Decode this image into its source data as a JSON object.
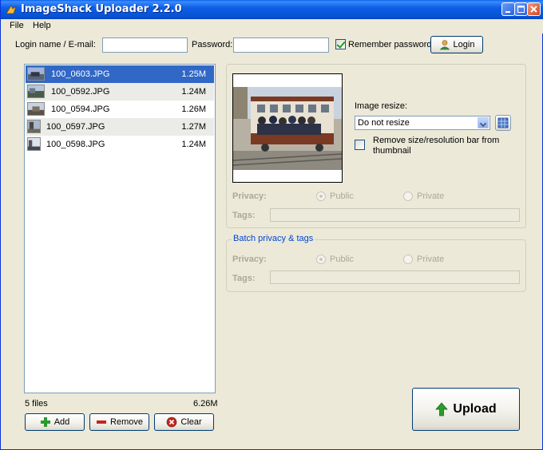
{
  "window": {
    "title": "ImageShack Uploader 2.2.0",
    "minimize": "_",
    "maximize": "□",
    "close": "×"
  },
  "menu": [
    "File",
    "Help"
  ],
  "login": {
    "login_label": "Login name / E-mail:",
    "login_value": "",
    "password_label": "Password:",
    "password_value": "",
    "remember_label": "Remember password",
    "remember_checked": true,
    "login_button": "Login"
  },
  "files": {
    "items": [
      {
        "name": "100_0603.JPG",
        "size": "1.25M",
        "selected": true
      },
      {
        "name": "100_0592.JPG",
        "size": "1.24M",
        "selected": false
      },
      {
        "name": "100_0594.JPG",
        "size": "1.26M",
        "selected": false
      },
      {
        "name": "100_0597.JPG",
        "size": "1.27M",
        "selected": false
      },
      {
        "name": "100_0598.JPG",
        "size": "1.24M",
        "selected": false
      }
    ],
    "count_label": "5 files",
    "total_size": "6.26M",
    "add_button": "Add",
    "remove_button": "Remove",
    "clear_button": "Clear"
  },
  "details": {
    "resize_label": "Image resize:",
    "resize_value": "Do not resize",
    "remove_bar_label": "Remove size/resolution bar from thumbnail",
    "remove_bar_checked": false,
    "privacy_label": "Privacy:",
    "public_label": "Public",
    "private_label": "Private",
    "tags_label": "Tags:"
  },
  "batch": {
    "title": "Batch privacy & tags",
    "privacy_label": "Privacy:",
    "public_label": "Public",
    "private_label": "Private",
    "tags_label": "Tags:"
  },
  "upload_button": "Upload",
  "colors": {
    "selection": "#3168c5",
    "titlebar": "#0652d4",
    "group_title": "#0046d5",
    "upload_arrow": "#2c9a2c",
    "remove_icon": "#c0281c",
    "clear_icon": "#c0281c"
  }
}
